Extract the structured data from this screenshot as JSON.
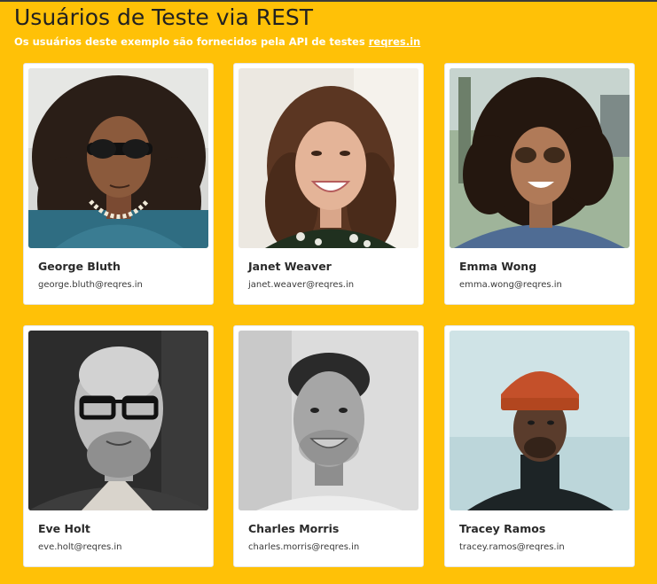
{
  "header": {
    "title": "Usuários de Teste via REST",
    "subtitle_prefix": "Os usuários deste exemplo são fornecidos pela API de testes ",
    "subtitle_link": "reqres.in"
  },
  "users": [
    {
      "name": "George Bluth",
      "email": "george.bluth@reqres.in",
      "photo": "avatar-photo"
    },
    {
      "name": "Janet Weaver",
      "email": "janet.weaver@reqres.in",
      "photo": "avatar-photo"
    },
    {
      "name": "Emma Wong",
      "email": "emma.wong@reqres.in",
      "photo": "avatar-photo"
    },
    {
      "name": "Eve Holt",
      "email": "eve.holt@reqres.in",
      "photo": "avatar-photo"
    },
    {
      "name": "Charles Morris",
      "email": "charles.morris@reqres.in",
      "photo": "avatar-photo"
    },
    {
      "name": "Tracey Ramos",
      "email": "tracey.ramos@reqres.in",
      "photo": "avatar-photo"
    }
  ],
  "colors": {
    "background": "#FFC107",
    "card": "#FFFFFF"
  }
}
